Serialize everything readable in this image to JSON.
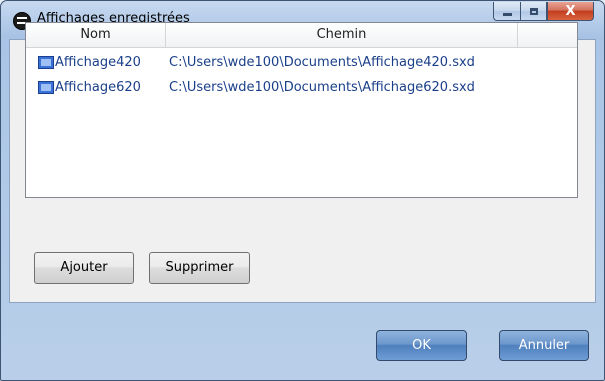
{
  "window": {
    "title": "Affichages enregistrées"
  },
  "caption_buttons": {
    "minimize_icon": "minimize-icon",
    "maximize_icon": "maximize-icon",
    "close_glyph": "X"
  },
  "list": {
    "columns": [
      "Nom",
      "Chemin"
    ],
    "rows": [
      {
        "name": "Affichage420",
        "path": "C:\\Users\\wde100\\Documents\\Affichage420.sxd",
        "icon": "view-file-icon"
      },
      {
        "name": "Affichage620",
        "path": "C:\\Users\\wde100\\Documents\\Affichage620.sxd",
        "icon": "view-file-icon"
      }
    ]
  },
  "actions": {
    "add_label": "Ajouter",
    "remove_label": "Supprimer"
  },
  "footer": {
    "ok_label": "OK",
    "cancel_label": "Annuler"
  },
  "colors": {
    "accent_blue": "#5a88c7",
    "close_red": "#c8442a",
    "row_text": "#1a3f8a"
  }
}
